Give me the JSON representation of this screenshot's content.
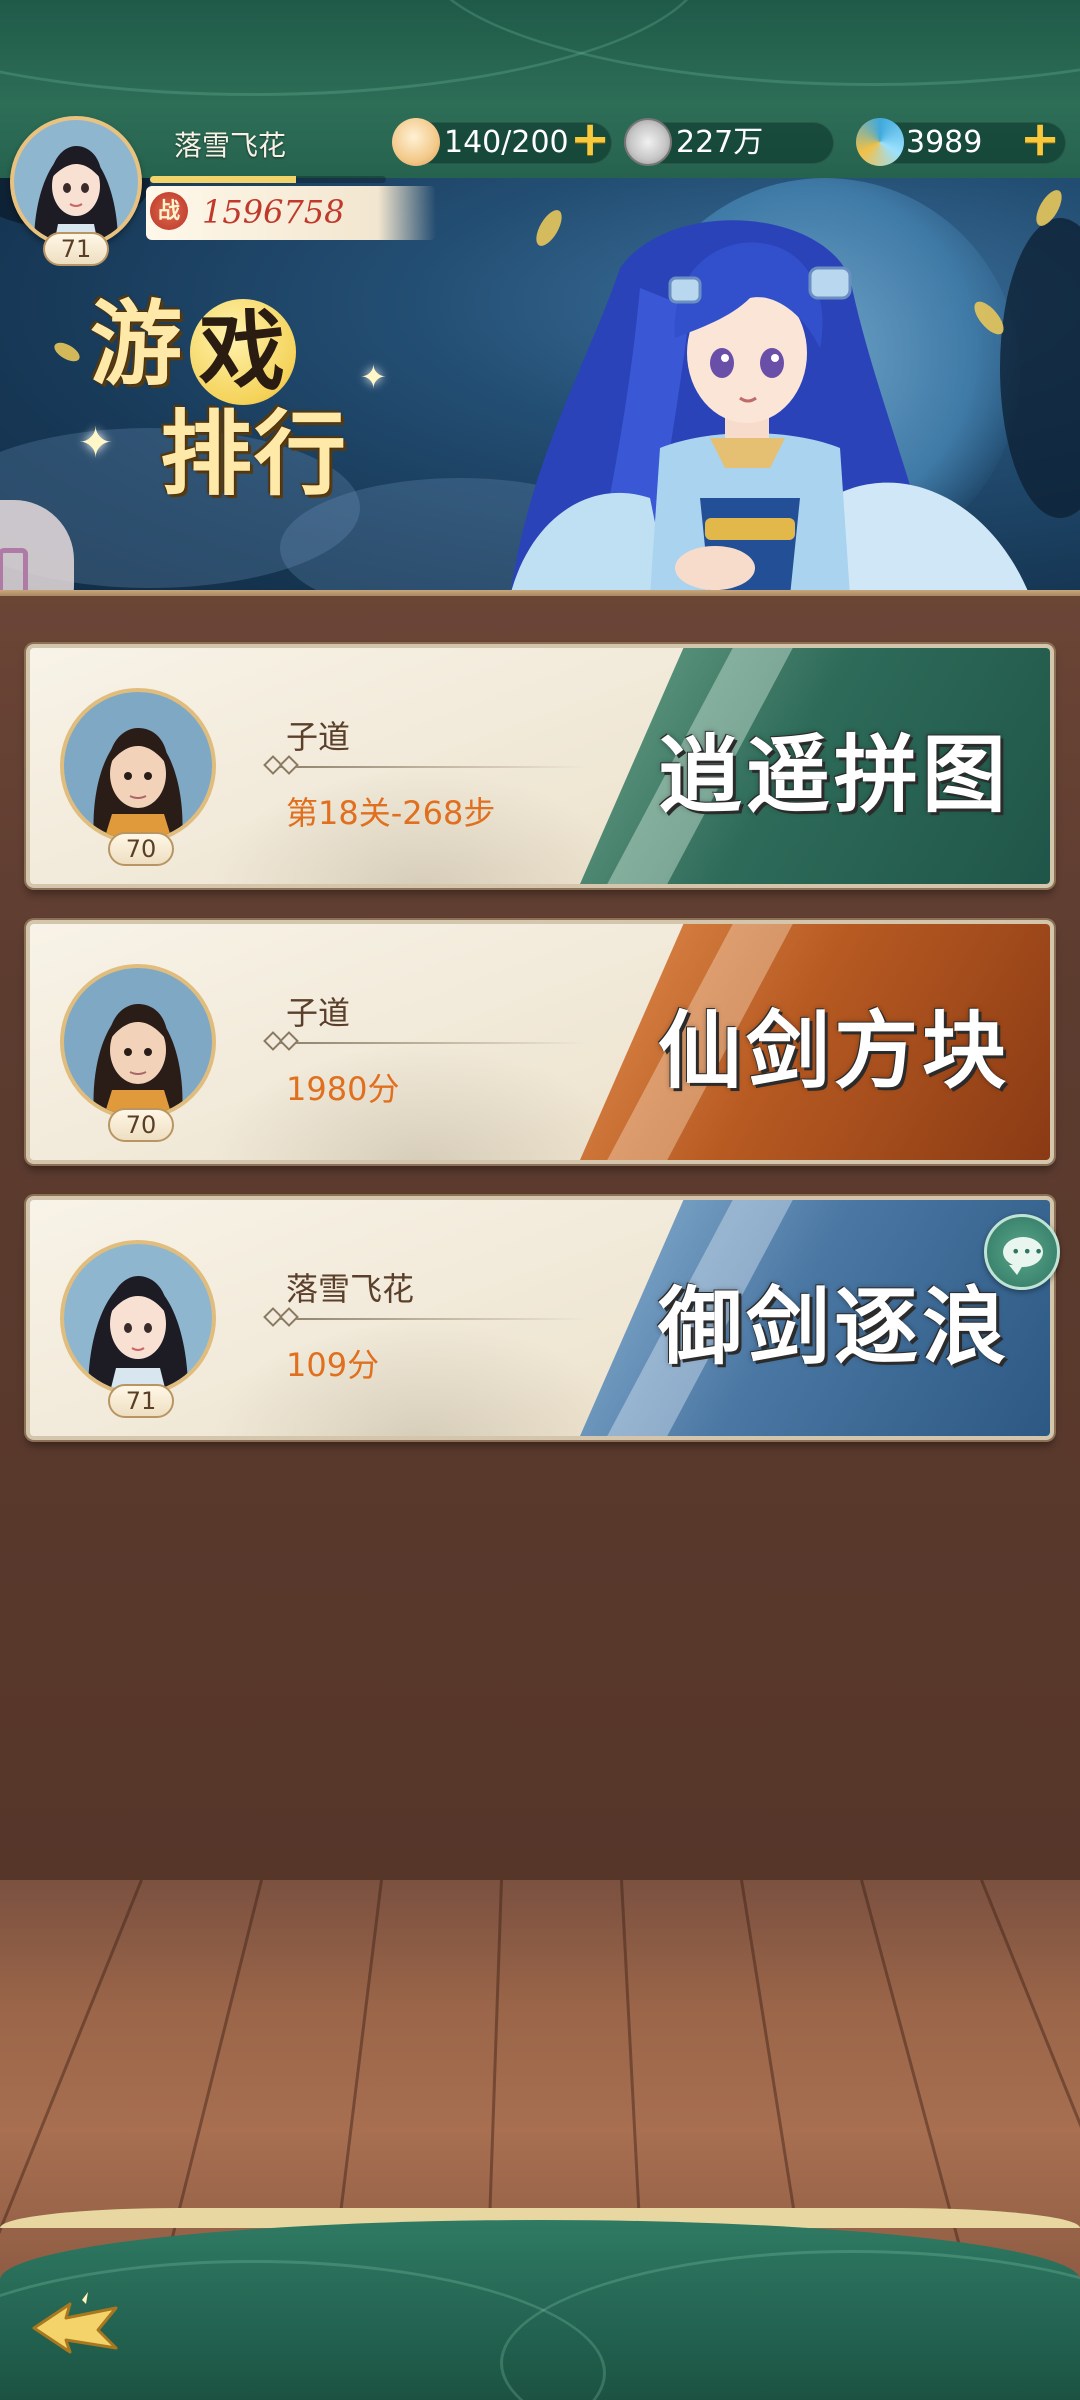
{
  "player": {
    "name": "落雪飞花",
    "level": "71",
    "power_label": "战",
    "power": "1596758",
    "exp_fraction": 0.62
  },
  "resources": [
    {
      "icon": "bun-icon",
      "value": "140/200",
      "has_plus": true
    },
    {
      "icon": "silver-coin-icon",
      "value": "227万",
      "has_plus": false
    },
    {
      "icon": "jade-swirl-icon",
      "value": "3989",
      "has_plus": true
    }
  ],
  "banner": {
    "title_part1": "游",
    "title_part2": "戏",
    "title_part3": "排行"
  },
  "rankings": [
    {
      "player": "子道",
      "level": "70",
      "score": "第18关-268步",
      "game": "逍遥拼图",
      "theme": "green"
    },
    {
      "player": "子道",
      "level": "70",
      "score": "1980分",
      "game": "仙剑方块",
      "theme": "orange"
    },
    {
      "player": "落雪飞花",
      "level": "71",
      "score": "109分",
      "game": "御剑逐浪",
      "theme": "blue"
    }
  ],
  "colors": {
    "accent_orange": "#e0701f",
    "power_red": "#c0392b",
    "gold": "#f7c93b",
    "panel_brown": "#5d3c30",
    "frame_green": "#2d6e57"
  }
}
